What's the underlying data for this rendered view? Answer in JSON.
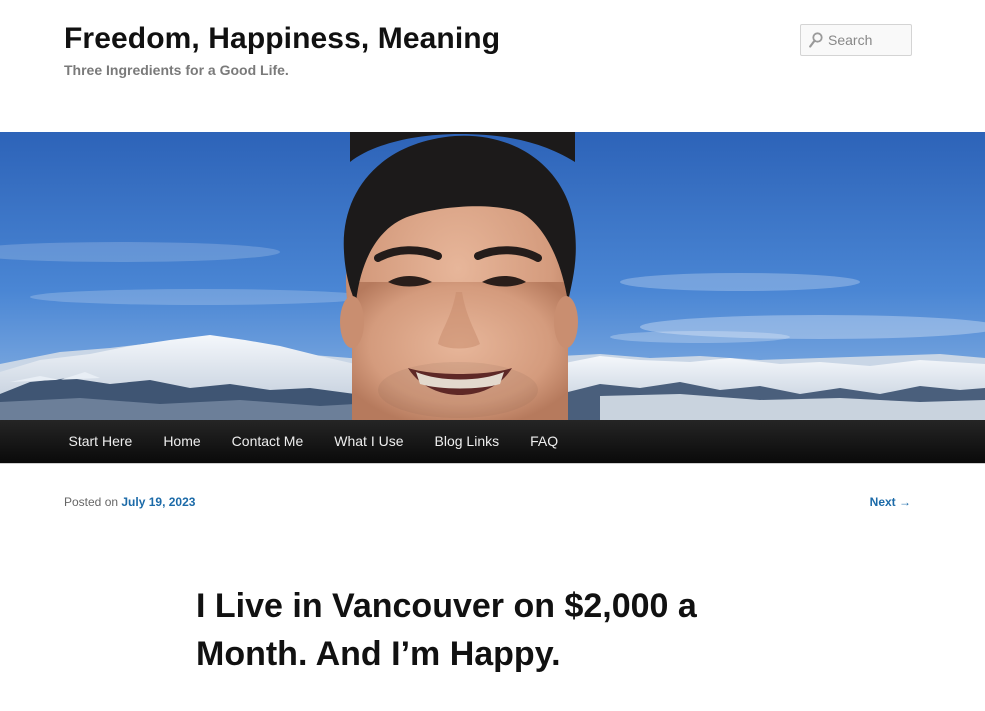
{
  "header": {
    "site_title": "Freedom, Happiness, Meaning",
    "site_description": "Three Ingredients for a Good Life."
  },
  "search": {
    "placeholder": "Search",
    "icon": "search-icon"
  },
  "banner": {
    "alt": "Header image"
  },
  "nav": {
    "items": [
      {
        "label": "Start Here"
      },
      {
        "label": "Home"
      },
      {
        "label": "Contact Me"
      },
      {
        "label": "What I Use"
      },
      {
        "label": "Blog Links"
      },
      {
        "label": "FAQ"
      }
    ]
  },
  "post": {
    "posted_on_label": "Posted on",
    "date": "July 19, 2023",
    "next_label": "Next →",
    "title": "I Live in Vancouver on $2,000 a Month. And I’m Happy."
  },
  "colors": {
    "link": "#1b6aa8",
    "nav_bg": "#111111",
    "title": "#111111"
  }
}
